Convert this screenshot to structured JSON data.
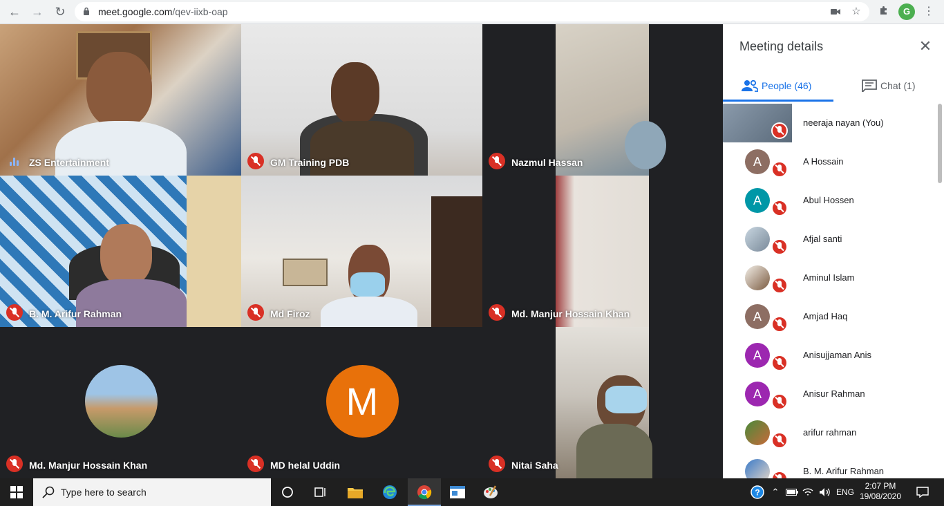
{
  "browser": {
    "url_host": "meet.google.com",
    "url_path": "/qev-iixb-oap",
    "profile_initial": "G"
  },
  "tiles": [
    {
      "name": "ZS Entertainment",
      "mic": "speaking"
    },
    {
      "name": "GM Training PDB",
      "mic": "muted"
    },
    {
      "name": "Nazmul Hassan",
      "mic": "muted"
    },
    {
      "name": "B. M. Arifur Rahman",
      "mic": "muted"
    },
    {
      "name": "Md Firoz",
      "mic": "muted"
    },
    {
      "name": "Md. Manjur Hossain Khan",
      "mic": "muted"
    },
    {
      "name": "Md. Manjur Hossain Khan",
      "mic": "muted"
    },
    {
      "name": "MD helal Uddin",
      "mic": "muted",
      "avatar_letter": "M"
    },
    {
      "name": "Nitai Saha",
      "mic": "muted"
    }
  ],
  "panel": {
    "title": "Meeting details",
    "tabs": [
      {
        "label": "People (46)",
        "icon": "people-icon",
        "active": true
      },
      {
        "label": "Chat (1)",
        "icon": "chat-icon",
        "active": false
      }
    ],
    "people": [
      {
        "name": "neeraja nayan (You)",
        "avatar": "photo"
      },
      {
        "name": "A Hossain",
        "letter": "A",
        "color": "#8d6e63"
      },
      {
        "name": "Abul Hossen",
        "letter": "A",
        "color": "#0097a7"
      },
      {
        "name": "Afjal santi",
        "avatar": "photo"
      },
      {
        "name": "Aminul Islam",
        "avatar": "photo"
      },
      {
        "name": "Amjad Haq",
        "letter": "A",
        "color": "#8d6e63"
      },
      {
        "name": "Anisujjaman Anis",
        "letter": "A",
        "color": "#9c27b0"
      },
      {
        "name": "Anisur Rahman",
        "letter": "A",
        "color": "#9c27b0"
      },
      {
        "name": "arifur rahman",
        "avatar": "photo"
      },
      {
        "name": "B. M. Arifur Rahman",
        "avatar": "photo"
      }
    ]
  },
  "taskbar": {
    "search_placeholder": "Type here to search",
    "language": "ENG",
    "time": "2:07 PM",
    "date": "19/08/2020"
  }
}
